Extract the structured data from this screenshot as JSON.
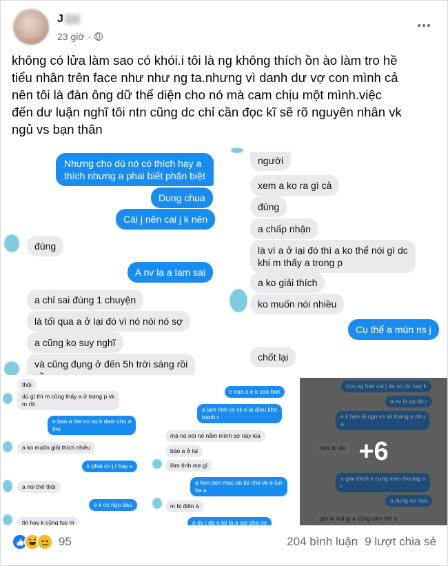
{
  "post": {
    "author": "J",
    "time": "23 giờ",
    "text_lines": [
      "không có lửa làm sao có khói.i tôi là ng không thích ồn ào làm tro hề",
      "tiểu nhân trên face như như ng ta.nhưng vì danh dư vợ con mình cả",
      "nên tôi  là đàn ông dữ thể diện cho nó mà cam chịu một mình.việc",
      "đến dư luận nghĩ tôi ntn cũng dc chỉ cần đọc kĩ sẽ rõ nguyên nhân vk",
      "ngủ vs bạn thân"
    ]
  },
  "photo1": [
    "Nhưng cho dù nó có thích hay a",
    "thích nhưng a phai biết phận biệt",
    "Dung chua",
    "Cái j nên cai j k nên",
    "đúng",
    "A nv la a lam sai",
    "a chỉ sai đúng 1 chuyện",
    "là tối qua a ở lại đó vì nó nói nó sợ",
    "a cũng ko suy nghĩ",
    "và cũng đụng ở đến 5h trời sáng rồi",
    "về"
  ],
  "photo2": [
    "người",
    "xem a ko ra gì cả",
    "đúng",
    "a chấp nhận",
    "là vì a ở lại đó thì a ko thể nói gì dc",
    "khi m thấy a trong p",
    "a ko giải thích",
    "ko muốn nói nhiều",
    "Cụ thể a mún ns j",
    "chốt lại"
  ],
  "photo3": [
    "thôi",
    "dù gì thì m cũng thấy a ở trong p vk",
    "m rồi",
    "e bao a the no so k dam cho a",
    "the",
    "a ko muốn giải thích nhiều",
    "k phai co j r hay s",
    "a nói thế thôi",
    "e k co ngu dau",
    "tin hay k cũng tuỳ m"
  ],
  "photo4": [
    "c cua a e k can biet",
    "a lam tinh vs vk e la dieu kho",
    "tranh r",
    "mà nó nói nó nằm mình sợ này kia",
    "bảo a ở lại",
    "làm tình mẹ gì",
    "a hen den muc do loi cho vk e lun",
    "ha a",
    "m bị điên à",
    "a du j da o lai la a sai pha co"
  ],
  "photo5": [
    "con ng biet cai j do an dc hay k",
    "a nv la qa do r",
    "e k hẹn di ngu vs vk thang e nhu",
    "a",
    "thôi đc rồi",
    "a giai thích e cung xem thuong a",
    "r",
    "a dung ns nua",
    "giờ m nói gì a cũng câm hết á"
  ],
  "more_photos": "+6",
  "reactions": {
    "count": "95",
    "comments": "204 bình luận",
    "shares": "9 lượt chia sẻ"
  },
  "colors": {
    "messenger_blue": "#1a8cf0",
    "bubble_grey": "#e9e9ee",
    "fb_blue": "#1877f2"
  }
}
